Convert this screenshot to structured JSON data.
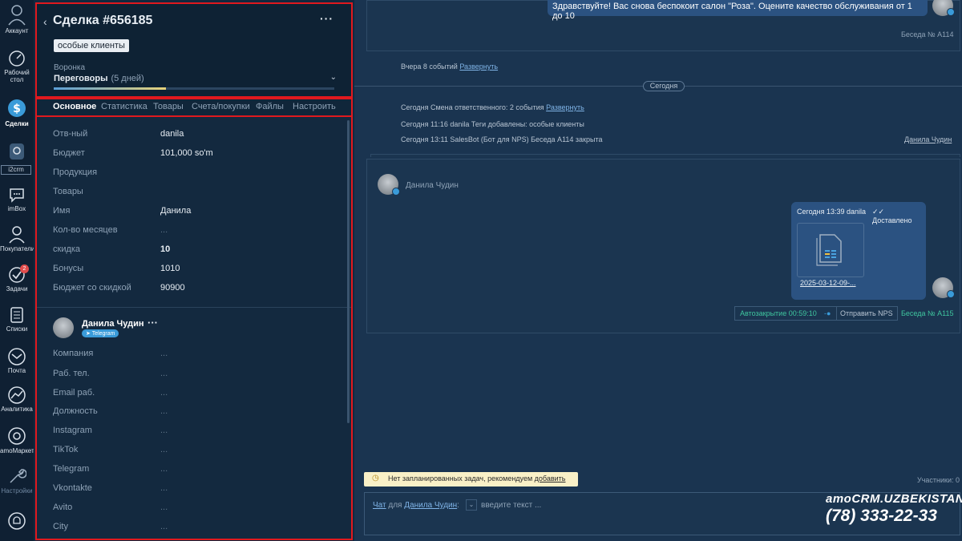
{
  "nav": {
    "account": "Аккаунт",
    "desktop": "Рабочий стол",
    "deals": "Сделки",
    "i2crm": "i2crm",
    "imbox": "imBox",
    "buyers": "Покупатели",
    "tasks": "Задачи",
    "tasks_badge": "2",
    "lists": "Списки",
    "mail": "Почта",
    "analytics": "Аналитика",
    "market": "amoМаркет",
    "settings": "Настройки"
  },
  "deal": {
    "back": "‹",
    "title": "Сделка #656185",
    "menu": "···",
    "tag": "особые клиенты",
    "funnel_label": "Воронка",
    "stage": "Переговоры",
    "stage_days": "(5 дней)",
    "stage_progress": 0.4
  },
  "tabs": [
    "Основное",
    "Статистика",
    "Товары",
    "Счета/покупки",
    "Файлы",
    "Настроить"
  ],
  "fields": [
    {
      "k": "Отв-ный",
      "v": "danila"
    },
    {
      "k": "Бюджет",
      "v": "101,000 so'm"
    },
    {
      "k": "Продукция",
      "v": ""
    },
    {
      "k": "Товары",
      "v": ""
    },
    {
      "k": "Имя",
      "v": "Данила"
    },
    {
      "k": "Кол-во месяцев",
      "v": "..."
    },
    {
      "k": "скидка",
      "v": "10"
    },
    {
      "k": "Бонусы",
      "v": "1010"
    },
    {
      "k": "Бюджет со скидкой",
      "v": "90900"
    }
  ],
  "contact": {
    "name": "Данила Чудин",
    "menu": "···",
    "channel": "Telegram",
    "fields": [
      {
        "k": "Компания",
        "v": "..."
      },
      {
        "k": "Раб. тел.",
        "v": "..."
      },
      {
        "k": "Email раб.",
        "v": "..."
      },
      {
        "k": "Должность",
        "v": "..."
      },
      {
        "k": "Instagram",
        "v": "..."
      },
      {
        "k": "TikTok",
        "v": "..."
      },
      {
        "k": "Telegram",
        "v": "..."
      },
      {
        "k": "Vkontakte",
        "v": "..."
      },
      {
        "k": "Avito",
        "v": "..."
      },
      {
        "k": "City",
        "v": "..."
      }
    ]
  },
  "feed": {
    "top_message": "Здравствуйте! Вас снова беспокоит салон \"Роза\". Оцените качество обслуживания от 1 до 10",
    "top_conv": "Беседа № A114",
    "yesterday": "Вчера 8 событий",
    "expand": "Развернуть",
    "today": "Сегодня",
    "event1": "Сегодня Смена ответственного: 2 события",
    "event2": "Сегодня 11:16 danila Теги добавлены: особые клиенты",
    "event3": "Сегодня 13:11 SalesBot (Бот для NPS) Беседа A114 закрыта",
    "event3_right": "Данила Чудин",
    "sender": "Данила Чудин",
    "msg_meta": "Сегодня 13:39 danila",
    "msg_status": "Доставлено",
    "file_name": "2025-03-12-09-...",
    "autoclose": "Автозакрытие 00:59:10",
    "send_nps": "Отправить NPS",
    "conv": "Беседа № A115"
  },
  "footer": {
    "no_tasks": "Нет запланированных задач, рекомендуем",
    "add": "добавить",
    "participants": "Участники: 0",
    "chat": "Чат",
    "for": "для",
    "chat_contact": "Данила Чудин",
    "chat_placeholder": "введите текст ..."
  },
  "brand": {
    "logo": "amoCRM.UZBEKISTAN",
    "phone": "(78) 333-22-33"
  }
}
